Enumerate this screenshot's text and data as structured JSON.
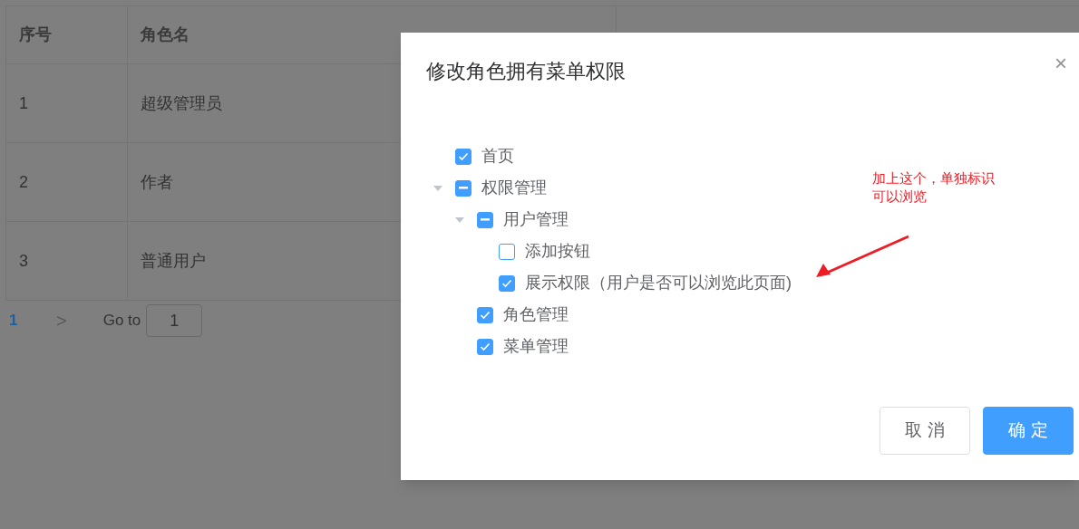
{
  "table": {
    "columns": [
      "序号",
      "角色名"
    ],
    "rows": [
      {
        "index": "1",
        "name": "超级管理员"
      },
      {
        "index": "2",
        "name": "作者"
      },
      {
        "index": "3",
        "name": "普通用户"
      }
    ]
  },
  "pagination": {
    "pages": [
      {
        "label": "1",
        "selected": true
      }
    ],
    "next": ">",
    "goto_label": "Go to",
    "goto_value": "1"
  },
  "dialog": {
    "title": "修改角色拥有菜单权限",
    "close": "×",
    "tree": [
      {
        "label": "首页",
        "checked": true,
        "indeterminate": false
      },
      {
        "label": "权限管理",
        "checked": false,
        "indeterminate": true,
        "expanded": true,
        "children": [
          {
            "label": "用户管理",
            "checked": false,
            "indeterminate": true,
            "expanded": true,
            "children": [
              {
                "label": "添加按钮",
                "checked": false,
                "indeterminate": false
              },
              {
                "label": "展示权限（用户是否可以浏览此页面)",
                "checked": true,
                "indeterminate": false
              }
            ]
          },
          {
            "label": "角色管理",
            "checked": true,
            "indeterminate": false
          },
          {
            "label": "菜单管理",
            "checked": true,
            "indeterminate": false
          }
        ]
      }
    ],
    "annotation": [
      "加上这个，单独标识",
      "可以浏览"
    ],
    "buttons": [
      {
        "label": "取 消",
        "kind": "secondary"
      },
      {
        "label": "确 定",
        "kind": "primary"
      }
    ]
  }
}
